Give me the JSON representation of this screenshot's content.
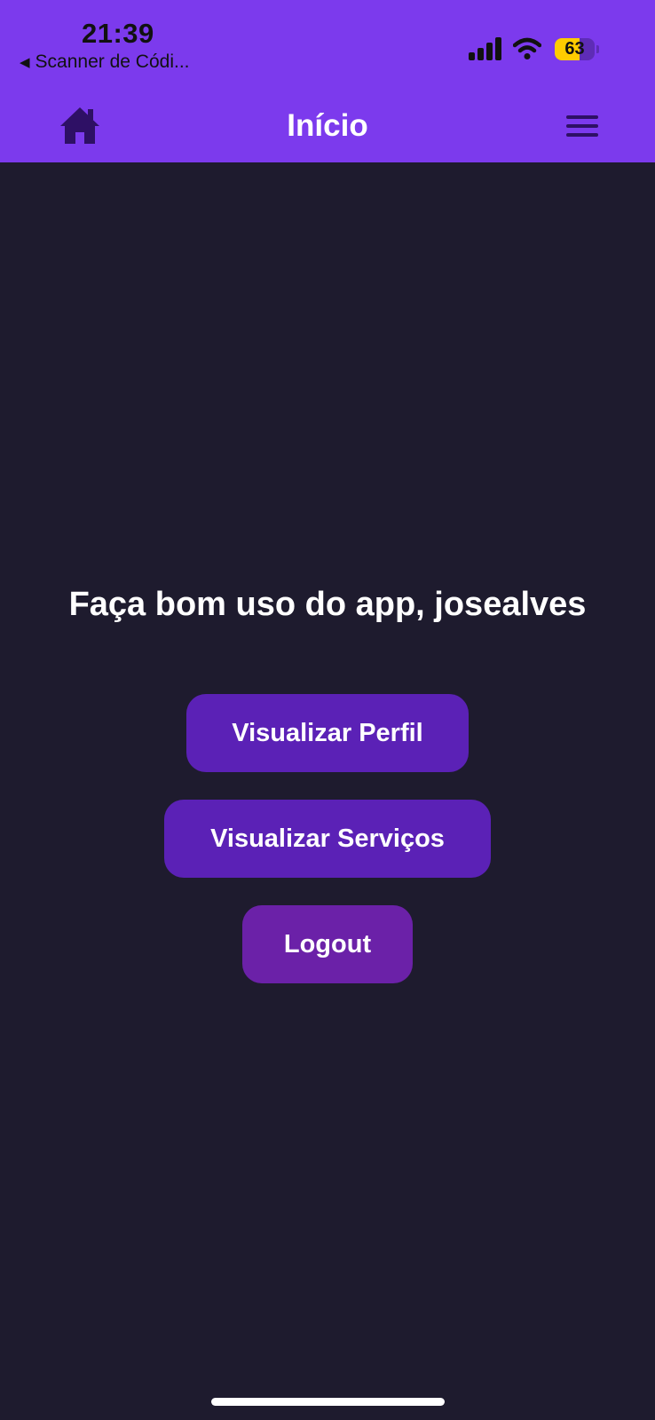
{
  "status_bar": {
    "time": "21:39",
    "back_app": "Scanner de Códi...",
    "battery_level": "63",
    "battery_fraction": 0.63
  },
  "header": {
    "title": "Início",
    "home_icon": "home-icon",
    "menu_icon": "hamburger-menu-icon"
  },
  "main": {
    "welcome": "Faça bom uso do app, josealves",
    "buttons": {
      "profile": "Visualizar Perfil",
      "services": "Visualizar Serviços",
      "logout": "Logout"
    }
  },
  "colors": {
    "header_bg": "#7c3aed",
    "page_bg": "#1e1b2e",
    "button_bg": "#5b21b6",
    "logout_bg": "#6b21a8",
    "icon_dark": "#2e1065",
    "battery": "#ffcc00"
  }
}
